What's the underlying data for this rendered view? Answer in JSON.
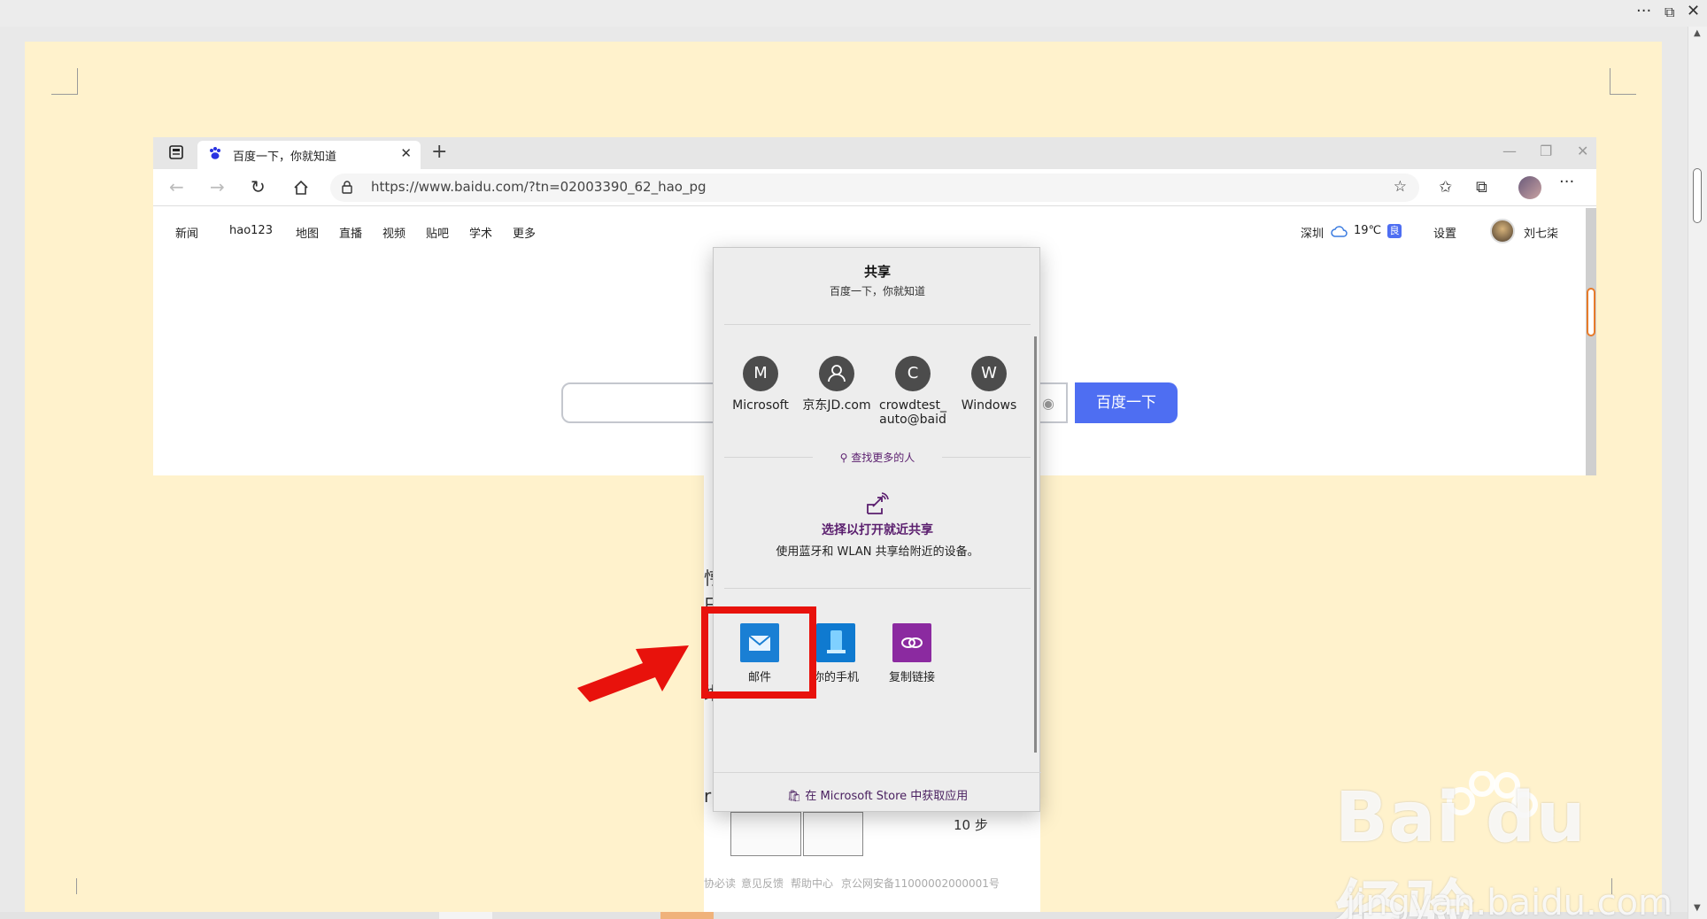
{
  "window": {
    "more": "···",
    "restore": "⧉",
    "close": "✕"
  },
  "browser": {
    "tab_title": "百度一下，你就知道",
    "tab_close": "✕",
    "new_tab": "+",
    "url": "https://www.baidu.com/?tn=02003390_62_hao_pg",
    "win_min": "—",
    "win_max": "❐",
    "win_close": "✕",
    "more": "···"
  },
  "baidu": {
    "nav": [
      "新闻",
      "hao123",
      "地图",
      "直播",
      "视频",
      "贴吧",
      "学术",
      "更多"
    ],
    "city": "深圳",
    "temp": "19℃",
    "air": "良",
    "settings": "设置",
    "user": "刘七柒",
    "search_button": "百度一下"
  },
  "lower_doc": {
    "frag1": "悙",
    "frag2": "曰",
    "frag3": "缃",
    "frag4": "r",
    "frag5": "10 步",
    "footer": [
      "协必读",
      "意见反馈",
      "帮助中心",
      "京公网安备11000002000001号"
    ]
  },
  "share": {
    "title": "共享",
    "subtitle": "百度一下，你就知道",
    "contacts": [
      {
        "initial": "M",
        "name": "Microsoft"
      },
      {
        "initial": "",
        "name": "京东JD.com"
      },
      {
        "initial": "C",
        "name": "crowdtest_auto@baid"
      },
      {
        "initial": "W",
        "name": "Windows"
      }
    ],
    "find_more": "查找更多的人",
    "nearby_title": "选择以打开就近共享",
    "nearby_desc": "使用蓝牙和 WLAN 共享给附近的设备。",
    "apps": [
      {
        "name": "邮件",
        "color": "#1a7fd4"
      },
      {
        "name": "你的手机",
        "color": "#0f7ad0"
      },
      {
        "name": "复制链接",
        "color": "#8b2aa0"
      }
    ],
    "store": "在 Microsoft Store 中获取应用"
  },
  "watermark": {
    "brand": "Bai du 经验",
    "url": "jingyan.baidu.com"
  }
}
